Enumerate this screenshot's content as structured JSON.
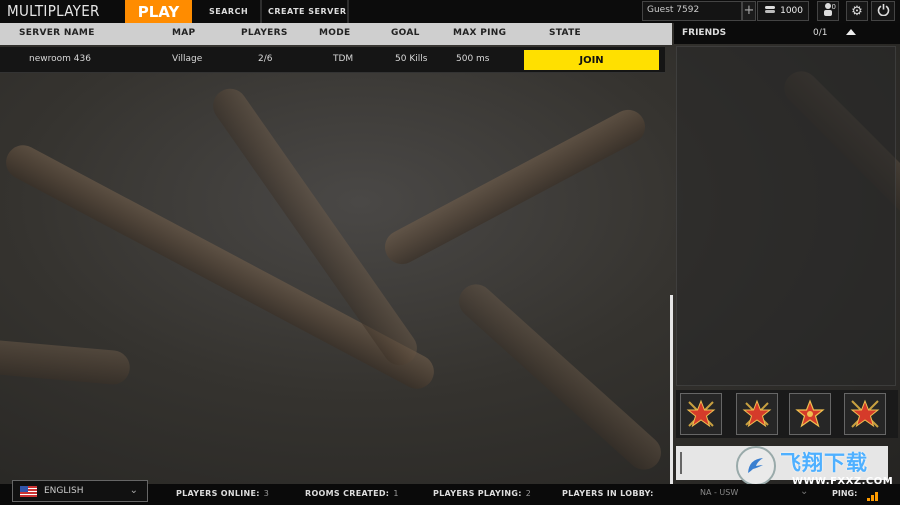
{
  "header": {
    "title": "MULTIPLAYER",
    "tabs": [
      {
        "label": "PLAY"
      },
      {
        "label": "SEARCH"
      },
      {
        "label": "CREATE SERVER"
      }
    ],
    "user": {
      "name": "Guest 7592",
      "plus": "+",
      "coins": "1000",
      "party_count": "0"
    }
  },
  "table": {
    "columns": [
      "SERVER NAME",
      "MAP",
      "PLAYERS",
      "MODE",
      "GOAL",
      "MAX PING",
      "STATE"
    ],
    "rows": [
      {
        "server_name": "newroom 436",
        "map": "Village",
        "players": "2/6",
        "mode": "TDM",
        "goal": "50 Kills",
        "max_ping": "500 ms",
        "state": "JOIN"
      }
    ]
  },
  "friends": {
    "title": "FRIENDS",
    "count": "0/1"
  },
  "status_bar": {
    "language": "ENGLISH",
    "players_online_label": "PLAYERS ONLINE:",
    "players_online": "3",
    "rooms_created_label": "ROOMS CREATED:",
    "rooms_created": "1",
    "players_playing_label": "PLAYERS PLAYING:",
    "players_playing": "2",
    "players_in_lobby_label": "PLAYERS IN LOBBY:",
    "players_in_lobby": "",
    "region": "NA - USW",
    "ping_label": "PING:"
  },
  "watermark": {
    "title": "飞翔下载",
    "url": "WWW.FXXZ.COM"
  },
  "colors": {
    "accent": "#ff8c00",
    "join": "#ffe000",
    "header_row": "#cfcfcf"
  }
}
